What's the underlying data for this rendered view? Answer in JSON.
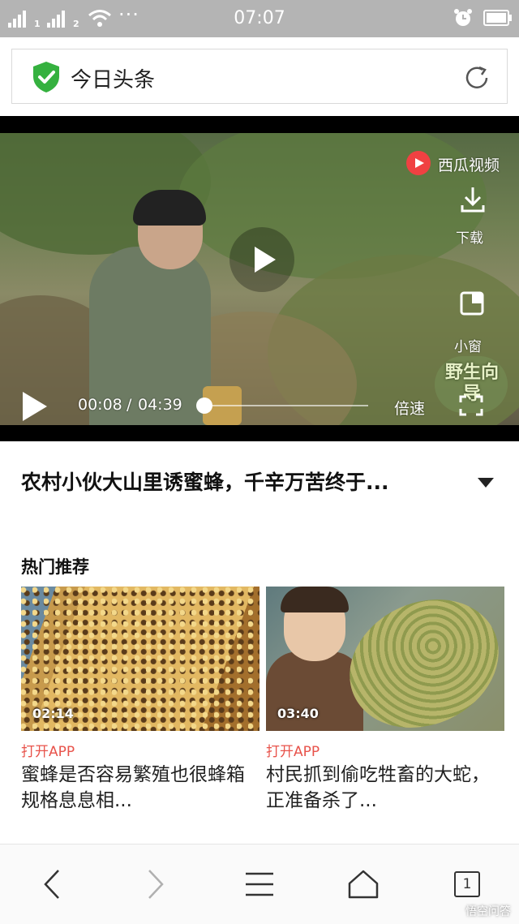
{
  "status_bar": {
    "time": "07:07",
    "sim1": "1",
    "sim2": "2",
    "dots": "···"
  },
  "address_bar": {
    "title": "今日头条"
  },
  "video": {
    "brand": "西瓜视频",
    "download_label": "下载",
    "mini_label": "小窗",
    "time_current": "00:08",
    "time_separator": " / ",
    "time_total": "04:39",
    "speed_label": "倍速",
    "watermark": "野生向导",
    "progress": 0.03
  },
  "video_title": "农村小伙大山里诱蜜蜂，千辛万苦终于...",
  "section_title": "热门推荐",
  "cards": [
    {
      "duration": "02:14",
      "open_app": "打开APP",
      "title": "蜜蜂是否容易繁殖也很蜂箱规格息息相..."
    },
    {
      "duration": "03:40",
      "open_app": "打开APP",
      "title": "村民抓到偷吃牲畜的大蛇，正准备杀了..."
    }
  ],
  "nav": {
    "tab_count": "1"
  },
  "watermark_bottom": "悟空问答"
}
